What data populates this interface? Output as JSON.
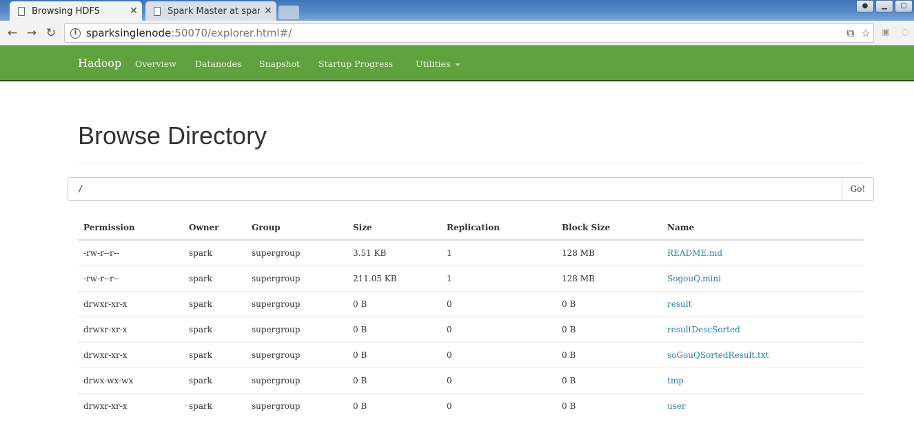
{
  "browser": {
    "tabs": [
      {
        "title": "Browsing HDFS",
        "active": true
      },
      {
        "title": "Spark Master at spark:/",
        "active": false
      }
    ],
    "address": {
      "host": "sparksinglenode",
      "rest": ":50070/explorer.html#/"
    }
  },
  "navbar": {
    "brand": "Hadoop",
    "links": [
      "Overview",
      "Datanodes",
      "Snapshot",
      "Startup Progress",
      "Utilities"
    ],
    "color": "#5fa33e"
  },
  "page": {
    "title": "Browse Directory",
    "path_value": "/",
    "go_label": "Go!"
  },
  "listing": {
    "columns": [
      "Permission",
      "Owner",
      "Group",
      "Size",
      "Replication",
      "Block Size",
      "Name"
    ],
    "rows": [
      {
        "permission": "-rw-r--r--",
        "owner": "spark",
        "group": "supergroup",
        "size": "3.51 KB",
        "replication": "1",
        "block_size": "128 MB",
        "name": "README.md"
      },
      {
        "permission": "-rw-r--r--",
        "owner": "spark",
        "group": "supergroup",
        "size": "211.05 KB",
        "replication": "1",
        "block_size": "128 MB",
        "name": "SogouQ.mini"
      },
      {
        "permission": "drwxr-xr-x",
        "owner": "spark",
        "group": "supergroup",
        "size": "0 B",
        "replication": "0",
        "block_size": "0 B",
        "name": "result"
      },
      {
        "permission": "drwxr-xr-x",
        "owner": "spark",
        "group": "supergroup",
        "size": "0 B",
        "replication": "0",
        "block_size": "0 B",
        "name": "resultDescSorted"
      },
      {
        "permission": "drwxr-xr-x",
        "owner": "spark",
        "group": "supergroup",
        "size": "0 B",
        "replication": "0",
        "block_size": "0 B",
        "name": "soGouQSortedResult.txt"
      },
      {
        "permission": "drwx-wx-wx",
        "owner": "spark",
        "group": "supergroup",
        "size": "0 B",
        "replication": "0",
        "block_size": "0 B",
        "name": "tmp"
      },
      {
        "permission": "drwxr-xr-x",
        "owner": "spark",
        "group": "supergroup",
        "size": "0 B",
        "replication": "0",
        "block_size": "0 B",
        "name": "user"
      }
    ]
  }
}
